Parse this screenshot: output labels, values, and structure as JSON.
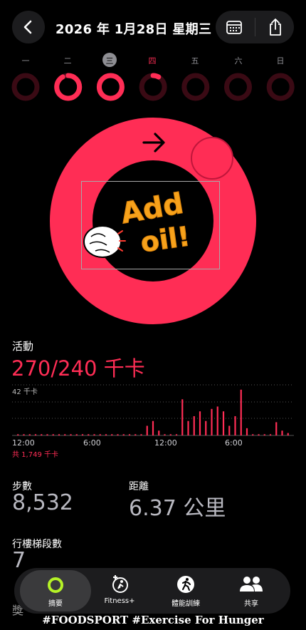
{
  "header": {
    "date_title": "2026 年 1月28日 星期三"
  },
  "week": {
    "days": [
      "一",
      "二",
      "三",
      "四",
      "五",
      "六",
      "日"
    ],
    "progress": [
      0.0,
      0.92,
      1.0,
      0.08,
      0.0,
      0.0,
      0.0
    ]
  },
  "sticker": {
    "line1": "Add",
    "line2": "oil!"
  },
  "activity": {
    "label": "活動",
    "value": "270/240 千卡",
    "ring_progress": 1.125,
    "chart_top_label": "42 千卡",
    "total": "共 1,749 千卡",
    "ticks": [
      "12:00",
      "6:00",
      "12:00",
      "6:00"
    ]
  },
  "chart_data": {
    "type": "bar",
    "x": [
      0.5,
      1,
      1.5,
      2,
      2.5,
      3,
      3.5,
      4,
      4.5,
      5,
      5.5,
      6,
      6.5,
      7,
      7.5,
      8,
      8.5,
      9,
      9.5,
      10,
      10.5,
      11,
      11.5,
      12,
      12.5,
      13,
      13.5,
      14,
      14.5,
      15,
      15.5,
      16,
      16.5,
      17,
      17.5,
      18,
      18.5,
      19,
      19.5,
      20,
      20.5,
      21,
      21.5,
      22,
      22.5,
      23,
      23.5
    ],
    "values": [
      1,
      1,
      1,
      1,
      1,
      1,
      1,
      1,
      1,
      1,
      1,
      1,
      1,
      1,
      1,
      1,
      1,
      1,
      1,
      1,
      1,
      1,
      8,
      12,
      4,
      1,
      1,
      1,
      30,
      12,
      16,
      20,
      12,
      22,
      24,
      20,
      8,
      16,
      38,
      6,
      1,
      1,
      1,
      1,
      11,
      4,
      2
    ],
    "ylim": [
      0,
      42
    ],
    "ylabel": "42 千卡"
  },
  "stats": {
    "steps_label": "步數",
    "steps_value": "8,532",
    "distance_label": "距離",
    "distance_value": "6.37 公里",
    "floors_label": "行樓梯段數",
    "floors_value": "7",
    "partial_label": "獎"
  },
  "tabs": [
    "摘要",
    "Fitness+",
    "體能訓練",
    "共享"
  ],
  "caption": "#FOODSPORT #Exercise For Hunger",
  "colors": {
    "accent": "#ff2d55",
    "dark_ring": "#3a0a14",
    "ring_track": "#4a0d1c"
  }
}
